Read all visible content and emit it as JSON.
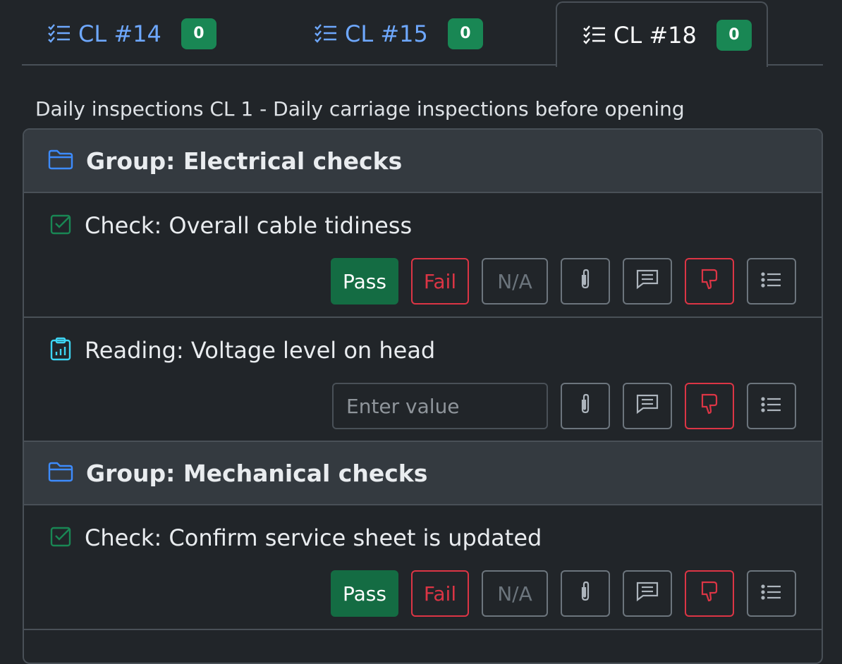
{
  "tabs": [
    {
      "label": "CL #14",
      "badge": "0",
      "active": false
    },
    {
      "label": "CL #15",
      "badge": "0",
      "active": false
    },
    {
      "label": "CL #18",
      "badge": "0",
      "active": true
    }
  ],
  "description": "Daily inspections CL 1 - Daily carriage inspections before opening",
  "groups": [
    {
      "title": "Group: Electrical checks",
      "items": [
        {
          "type": "check",
          "title": "Check: Overall cable tidiness",
          "pass": "Pass",
          "fail": "Fail",
          "na": "N/A"
        },
        {
          "type": "reading",
          "title": "Reading: Voltage level on head",
          "placeholder": "Enter value"
        }
      ]
    },
    {
      "title": "Group: Mechanical checks",
      "items": [
        {
          "type": "check",
          "title": "Check: Confirm service sheet is updated",
          "pass": "Pass",
          "fail": "Fail",
          "na": "N/A"
        }
      ]
    }
  ],
  "colors": {
    "accent": "#6ea8fe",
    "success": "#198754",
    "danger": "#dc3545",
    "muted": "#6c757d",
    "reading_icon": "#3dd5f3"
  }
}
